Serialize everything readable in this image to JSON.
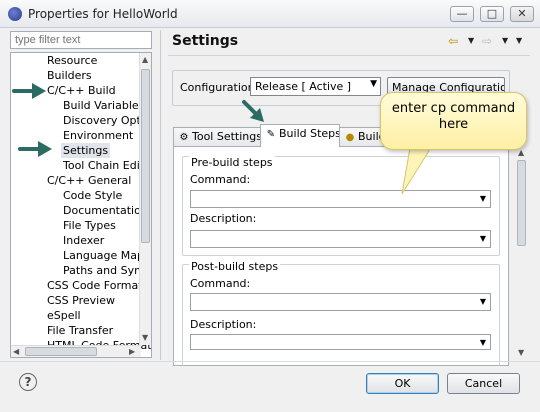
{
  "window": {
    "title": "Properties for HelloWorld",
    "minimize_glyph": "—",
    "maximize_glyph": "□",
    "close_glyph": "✕"
  },
  "filter": {
    "placeholder": "type filter text"
  },
  "tree": {
    "items": [
      {
        "label": "Resource"
      },
      {
        "label": "Builders"
      },
      {
        "label": "C/C++ Build"
      },
      {
        "label": "Build Variables"
      },
      {
        "label": "Discovery Option"
      },
      {
        "label": "Environment"
      },
      {
        "label": "Settings"
      },
      {
        "label": "Tool Chain Edito"
      },
      {
        "label": "C/C++ General"
      },
      {
        "label": "Code Style"
      },
      {
        "label": "Documentation"
      },
      {
        "label": "File Types"
      },
      {
        "label": "Indexer"
      },
      {
        "label": "Language Mappi"
      },
      {
        "label": "Paths and Symbo"
      },
      {
        "label": "CSS Code Formatter"
      },
      {
        "label": "CSS Preview"
      },
      {
        "label": "eSpell"
      },
      {
        "label": "File Transfer"
      },
      {
        "label": "HTML Code Formatt"
      }
    ]
  },
  "settings": {
    "title": "Settings",
    "config_label": "Configuration:",
    "config_value": "Release  [ Active ]",
    "manage_label": "Manage Configurations..."
  },
  "tabs": [
    {
      "label": "Tool Settings"
    },
    {
      "label": "Build Steps"
    },
    {
      "label": "Build"
    }
  ],
  "build_steps": {
    "pre": {
      "legend": "Pre-build steps",
      "command_label": "Command:",
      "description_label": "Description:"
    },
    "post": {
      "legend": "Post-build steps",
      "command_label": "Command:",
      "description_label": "Description:"
    }
  },
  "callout": {
    "text": "enter cp command here"
  },
  "buttons": {
    "help": "?",
    "ok": "OK",
    "cancel": "Cancel"
  },
  "colors": {
    "arrow": "#2b6b61",
    "callout_fill": "#fff4b8",
    "accent": "#3c7fb1"
  }
}
